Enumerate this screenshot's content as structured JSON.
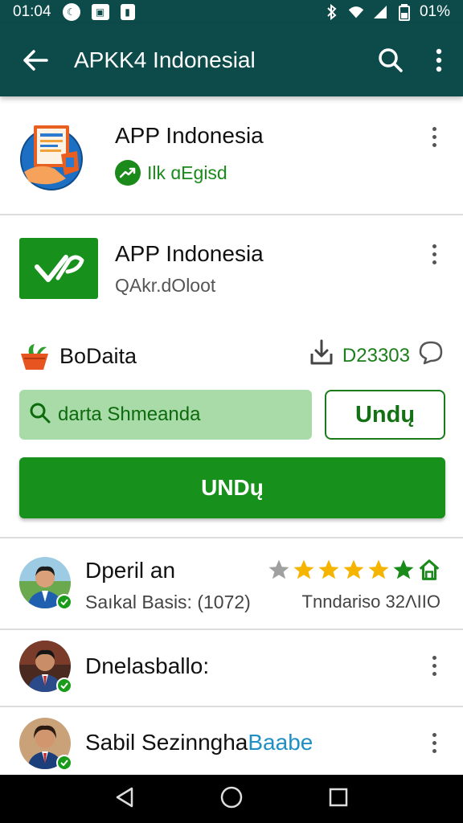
{
  "status_bar": {
    "time": "01:04",
    "battery": "01%"
  },
  "app_bar": {
    "title": "APKK4 Indonesial"
  },
  "apps": [
    {
      "name": "APP Indonesia",
      "subtitle": "Ilk ɑEgisd"
    },
    {
      "name": "APP Indonesia",
      "subtitle": "QAkr.dOloot"
    }
  ],
  "stats": {
    "label": "BoDaita",
    "downloads": "D23303"
  },
  "search": {
    "value": "darta Shmeanda"
  },
  "buttons": {
    "outline_label": "Undų",
    "primary_label": "UNDų"
  },
  "reviews": [
    {
      "name": "Dperil an",
      "subtitle": "Saıkal Basis: (1072)",
      "right_text": "Tnndariso 32ΛΙΙΟ",
      "rating": 5
    },
    {
      "name": "Dnelasballo:"
    },
    {
      "name": "Sabil Sezinngha",
      "name_suffix": "Baabe"
    }
  ],
  "colors": {
    "app_bar": "#0d4b4b",
    "accent_green": "#18901c",
    "search_bg": "#a8dba8",
    "star_gold": "#f4b400"
  }
}
